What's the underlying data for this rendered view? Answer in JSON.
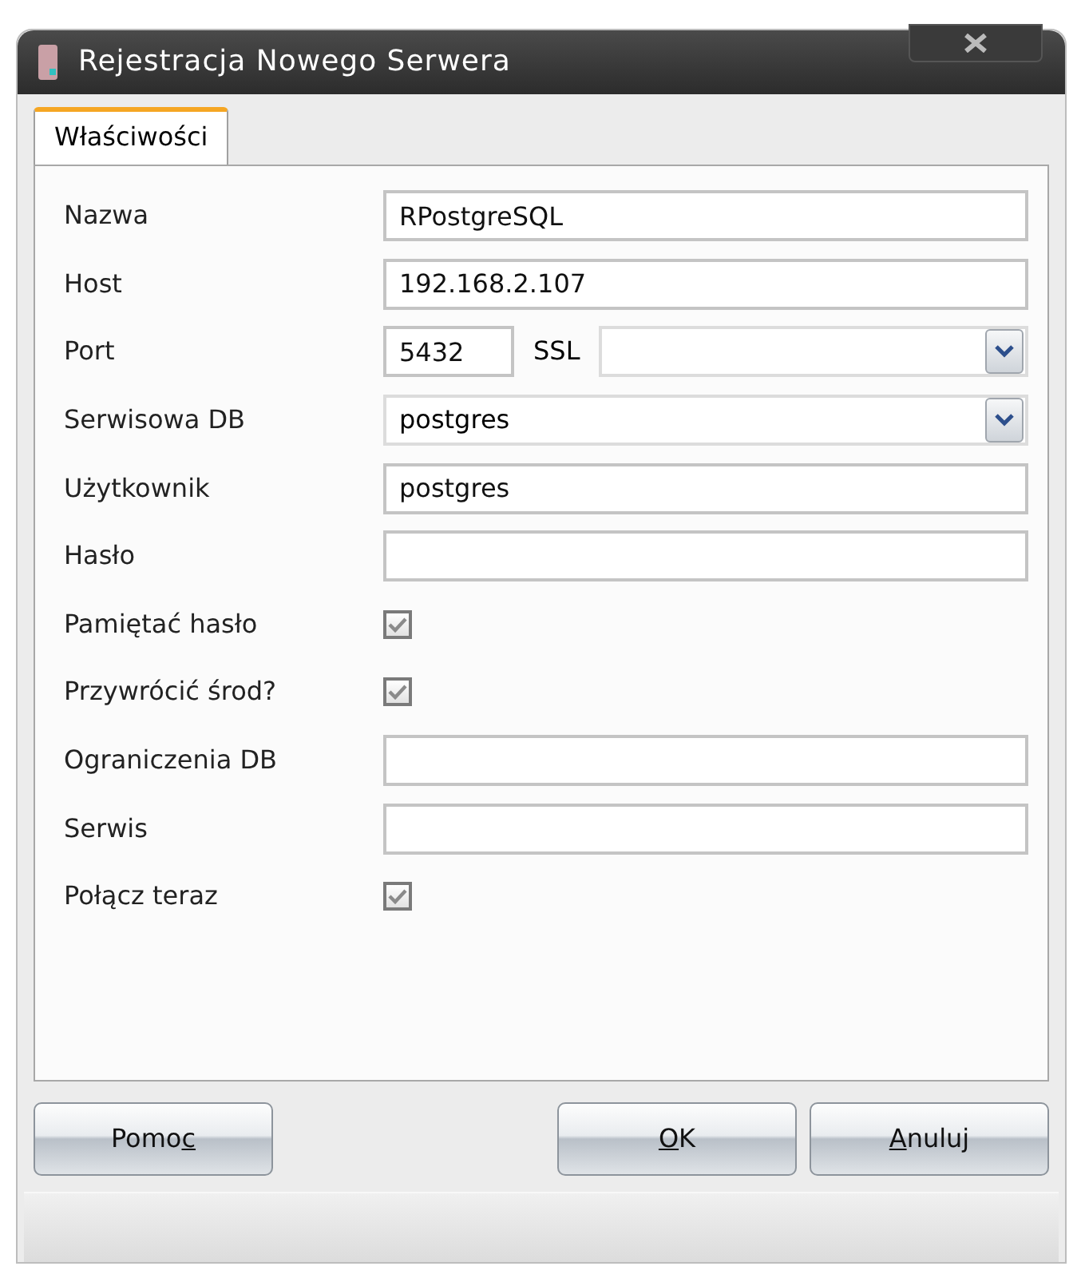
{
  "window": {
    "title": "Rejestracja Nowego Serwera"
  },
  "tabs": [
    {
      "label": "Właściwości",
      "selected": true
    }
  ],
  "fields": [
    {
      "kind": "text",
      "label": "Nazwa",
      "value": "RPostgreSQL"
    },
    {
      "kind": "text",
      "label": "Host",
      "value": "192.168.2.107"
    },
    {
      "kind": "port",
      "label": "Port",
      "value": "5432",
      "ssl_label": "SSL"
    },
    {
      "kind": "combo",
      "label": "Serwisowa DB",
      "value": "postgres"
    },
    {
      "kind": "text",
      "label": "Użytkownik",
      "value": "postgres"
    },
    {
      "kind": "text",
      "label": "Hasło"
    },
    {
      "kind": "checkbox",
      "label": "Pamiętać hasło",
      "checked": true
    },
    {
      "kind": "checkbox",
      "label": "Przywrócić środ?",
      "checked": true
    },
    {
      "kind": "text",
      "label": "Ograniczenia DB"
    },
    {
      "kind": "text",
      "label": "Serwis"
    },
    {
      "kind": "checkbox",
      "label": "Połącz teraz",
      "checked": true
    }
  ],
  "buttons": [
    {
      "kind": "help",
      "before": "Pomo",
      "mnemonic": "c"
    },
    {
      "kind": "action",
      "mnemonic": "O",
      "after": "K"
    },
    {
      "kind": "action",
      "mnemonic": "A",
      "after": "nuluj"
    }
  ]
}
